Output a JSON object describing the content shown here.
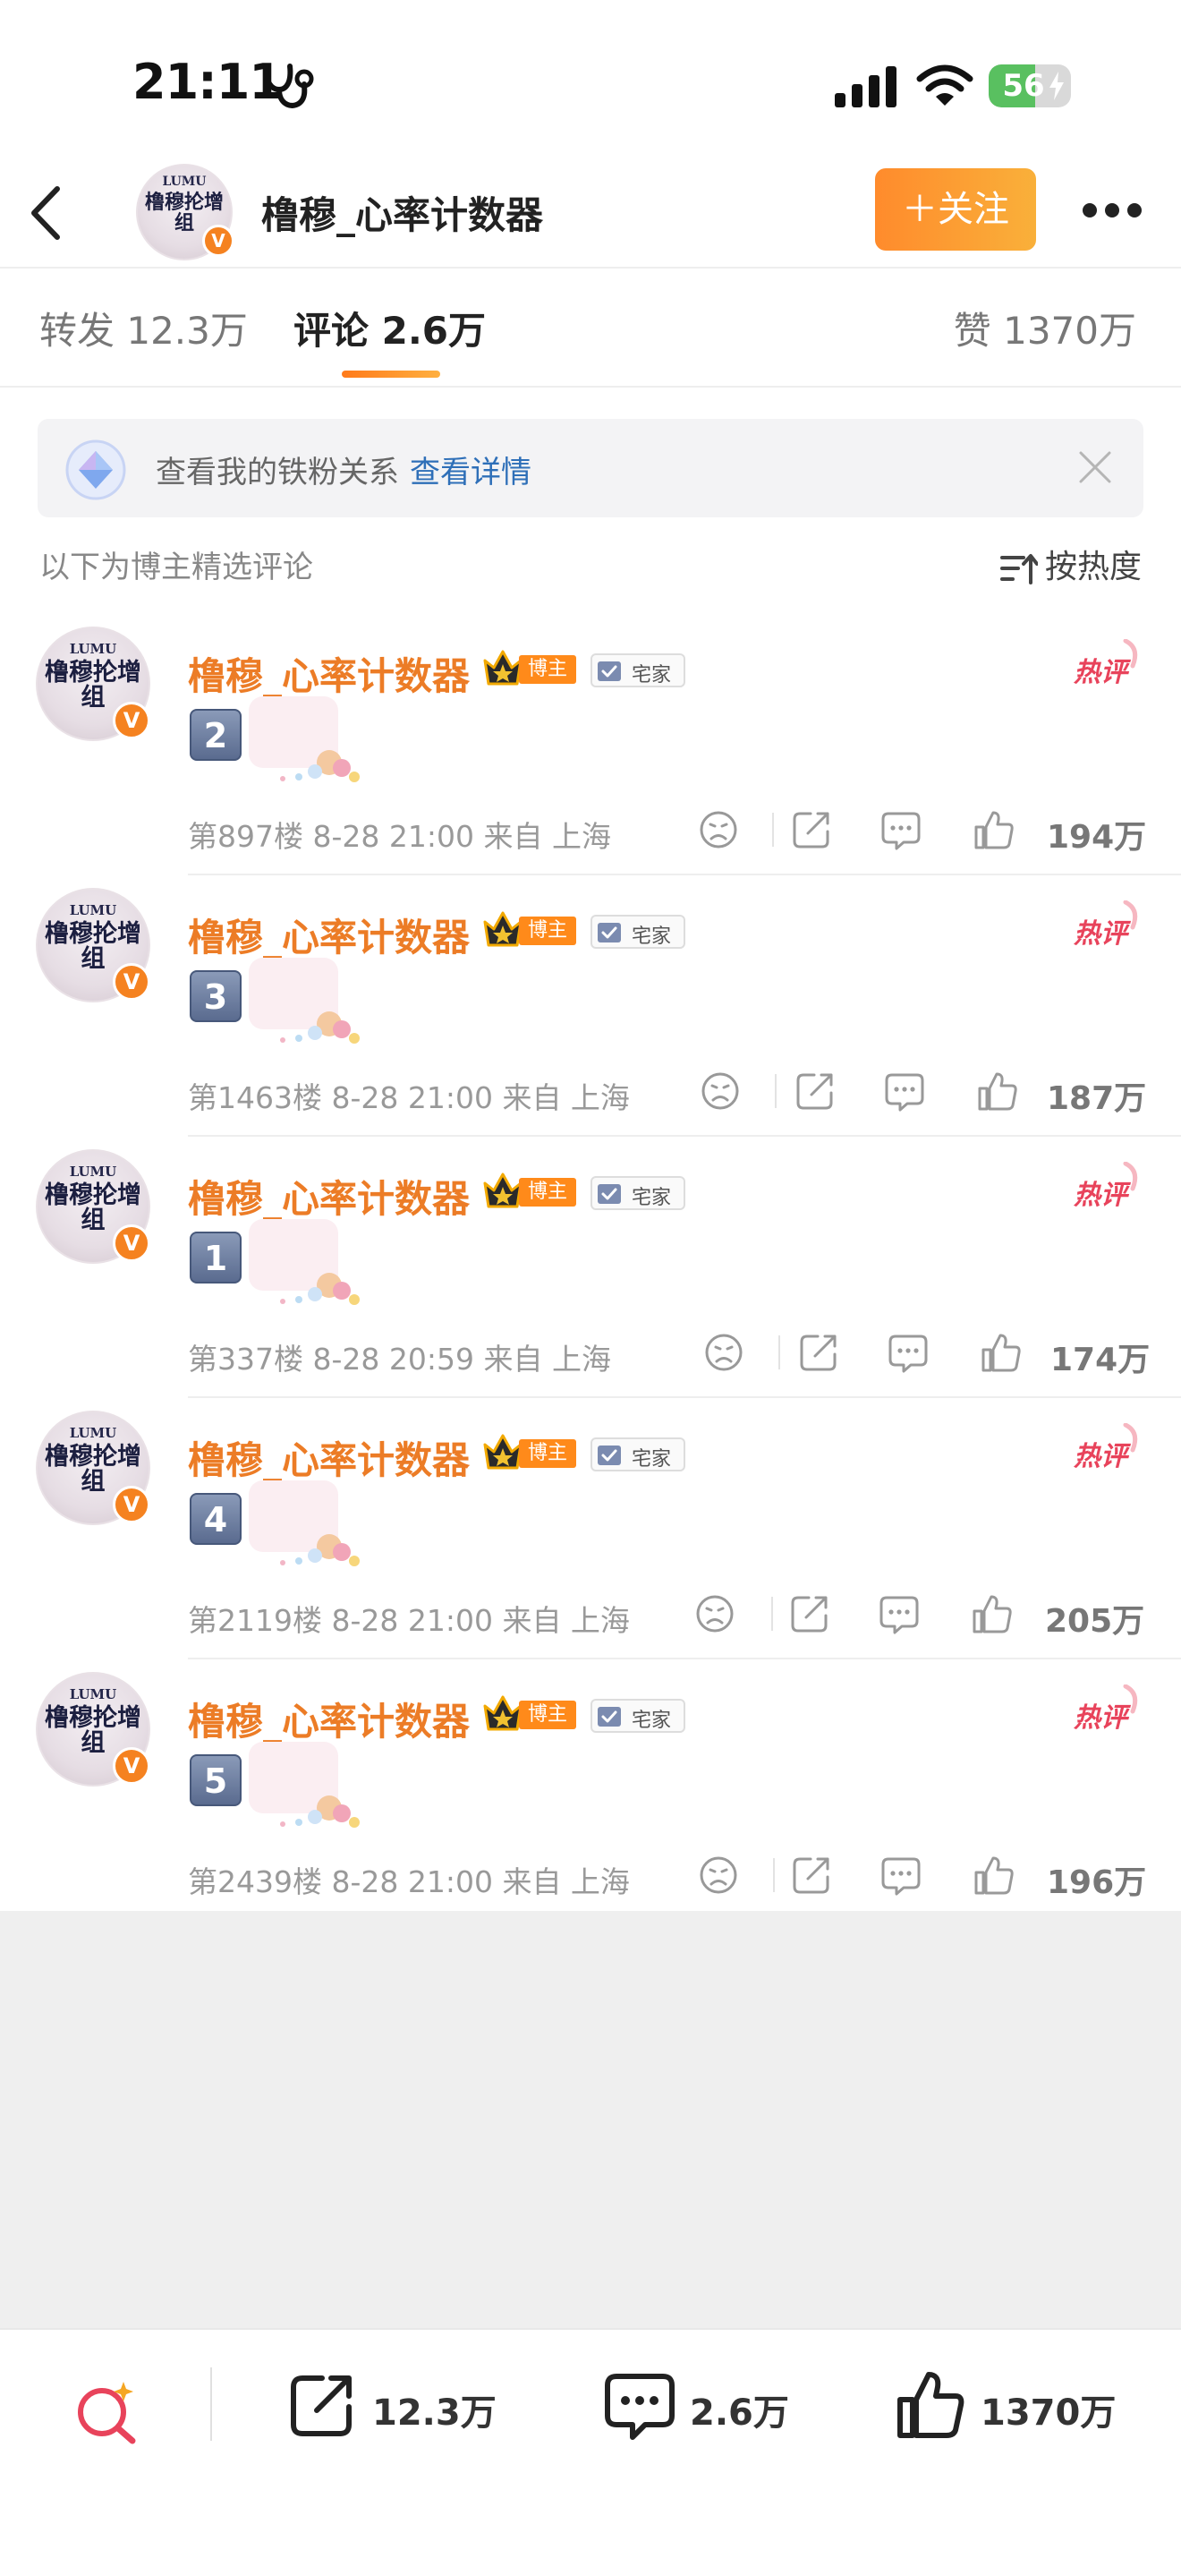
{
  "status": {
    "time": "21:11",
    "battery": "56",
    "battery_level": 0.56,
    "icons": [
      "stethoscope-icon",
      "cellular-signal-icon",
      "wifi-icon",
      "battery-icon"
    ]
  },
  "header": {
    "back_icon": "chevron-left-icon",
    "avatar_top": "LUMU",
    "avatar_main": "橹穆抡增组",
    "title": "橹穆_心率计数器",
    "follow_label": "＋关注",
    "more_icon": "ellipsis-icon"
  },
  "tabs": {
    "repost": "转发 12.3万",
    "comment": "评论 2.6万",
    "like": "赞 1370万"
  },
  "fan_banner": {
    "text": "查看我的铁粉关系",
    "link": "查看详情"
  },
  "section": {
    "title": "以下为博主精选评论",
    "sort_label": "按热度"
  },
  "comments": [
    {
      "name": "橹穆_心率计数器",
      "blogger_tag": "博主",
      "home_tag": "宅家",
      "hot_tag": "热评",
      "num": "2",
      "meta": "第897楼 8-28 21:00 来自 上海",
      "likes": "194万"
    },
    {
      "name": "橹穆_心率计数器",
      "blogger_tag": "博主",
      "home_tag": "宅家",
      "hot_tag": "热评",
      "num": "3",
      "meta": "第1463楼 8-28 21:00 来自 上海",
      "likes": "187万"
    },
    {
      "name": "橹穆_心率计数器",
      "blogger_tag": "博主",
      "home_tag": "宅家",
      "hot_tag": "热评",
      "num": "1",
      "meta": "第337楼 8-28 20:59 来自 上海",
      "likes": "174万"
    },
    {
      "name": "橹穆_心率计数器",
      "blogger_tag": "博主",
      "home_tag": "宅家",
      "hot_tag": "热评",
      "num": "4",
      "meta": "第2119楼 8-28 21:00 来自 上海",
      "likes": "205万"
    },
    {
      "name": "橹穆_心率计数器",
      "blogger_tag": "博主",
      "home_tag": "宅家",
      "hot_tag": "热评",
      "num": "5",
      "meta": "第2439楼 8-28 21:00 来自 上海",
      "likes": "196万"
    }
  ],
  "bottom_bar": {
    "reposts": "12.3万",
    "comments": "2.6万",
    "likes": "1370万"
  },
  "colors": {
    "accent": "#ec7c26",
    "link": "#2e6fb8",
    "hot": "#e8435b"
  }
}
